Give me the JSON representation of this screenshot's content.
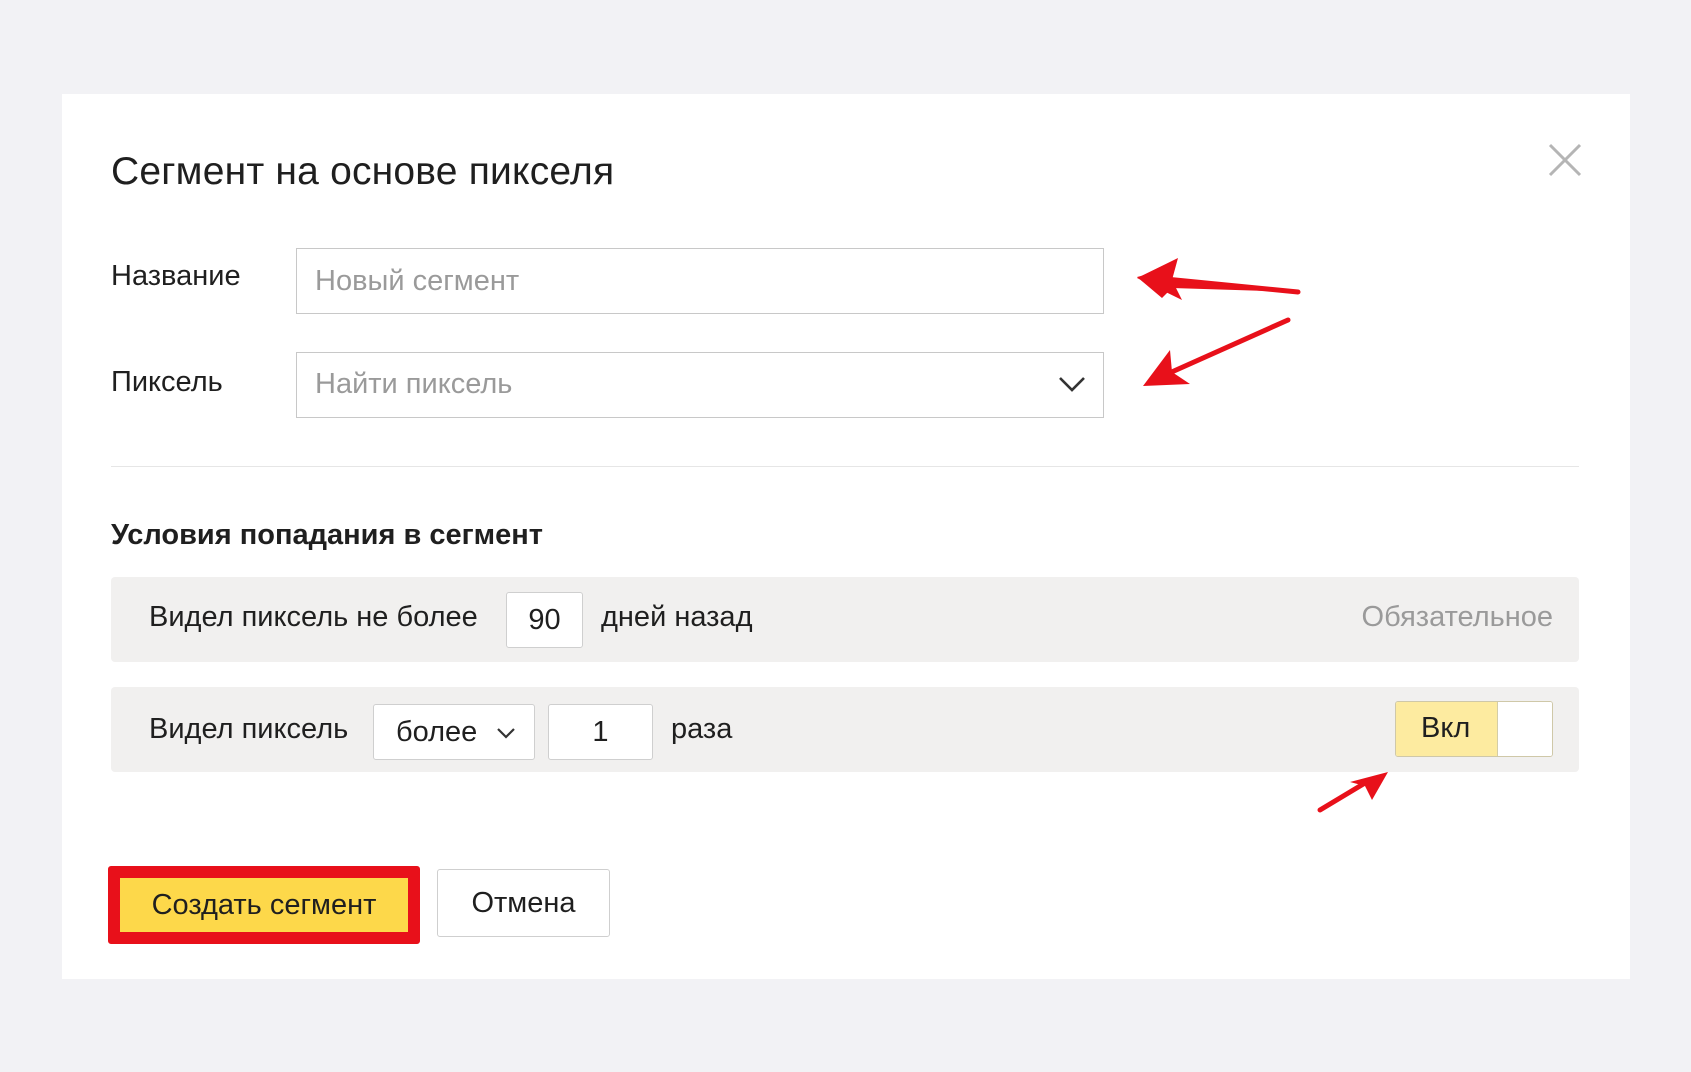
{
  "dialog": {
    "title": "Сегмент на основе пикселя",
    "close_icon": "close-icon"
  },
  "form": {
    "name_label": "Название",
    "name_placeholder": "Новый сегмент",
    "name_value": "",
    "pixel_label": "Пиксель",
    "pixel_placeholder": "Найти пиксель",
    "pixel_icon": "chevron-down-icon"
  },
  "conditions": {
    "title": "Условия попадания в сегмент",
    "row1": {
      "prefix": "Видел пиксель не более",
      "days_value": "90",
      "suffix": "дней назад",
      "status": "Обязательное"
    },
    "row2": {
      "prefix": "Видел пиксель",
      "comparison_selected": "более",
      "count_value": "1",
      "suffix": "раза",
      "toggle_label": "Вкл",
      "toggle_on": true
    }
  },
  "actions": {
    "create_label": "Создать сегмент",
    "cancel_label": "Отмена"
  },
  "colors": {
    "accent_yellow": "#fdd84a",
    "toggle_yellow": "#fdeba0",
    "annotation_red": "#e8101a",
    "condition_bg": "#f1f0ef",
    "page_bg": "#f2f2f5"
  }
}
